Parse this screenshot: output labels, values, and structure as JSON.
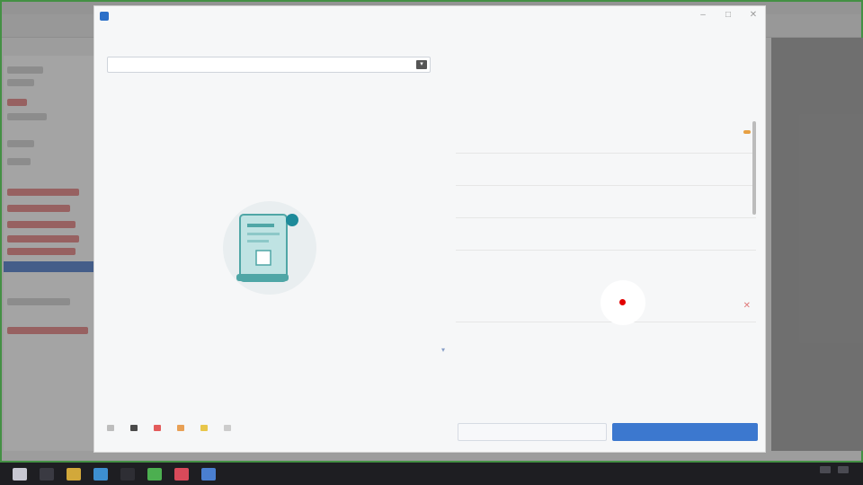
{
  "dialog": {
    "title": "",
    "window_controls": [
      "–",
      "□",
      "✕"
    ],
    "section_top_label": "",
    "select_value": "",
    "section_left_label": "",
    "section_right_label": "",
    "section_right2_label": "",
    "empty_text_line1": "",
    "empty_text_line2": "",
    "list_a": [
      {
        "name": "",
        "sub": "",
        "tag": ""
      },
      {
        "name": "",
        "sub": ""
      },
      {
        "name": "",
        "sub": ""
      },
      {
        "name": "",
        "sub": ""
      }
    ],
    "list_b": [
      {
        "name": "",
        "sub": "",
        "delete_icon": "✕"
      }
    ],
    "legend": [
      {
        "label": "",
        "color": "#bdbdbd"
      },
      {
        "label": "",
        "color": "#4a4a4a"
      },
      {
        "label": "",
        "color": "#e35b5b"
      },
      {
        "label": "",
        "color": "#e8a055"
      },
      {
        "label": "",
        "color": "#e8c64a"
      },
      {
        "label": "",
        "color": "#cccccc"
      }
    ],
    "cancel_label": "",
    "confirm_label": ""
  },
  "colors": {
    "accent": "#3c78cf",
    "section_label": "#3f63a8",
    "tag": "#e7a043"
  },
  "taskbar": {
    "icons": [
      "windows-icon",
      "search-icon",
      "folder-icon",
      "edge-icon",
      "terminal-icon",
      "app-icon",
      "app-icon",
      "app-icon"
    ],
    "clock": ""
  }
}
